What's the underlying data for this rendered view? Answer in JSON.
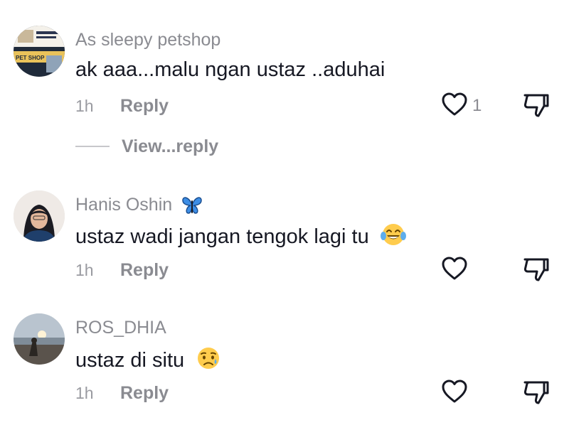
{
  "comments": [
    {
      "username": "As sleepy petshop",
      "text": "ak aaa...malu ngan ustaz ..aduhai",
      "emoji": "",
      "time": "1h",
      "reply_label": "Reply",
      "like_count": "1",
      "view_replies_label": "View...reply",
      "avatar_text": "PET SHOP"
    },
    {
      "username": "Hanis Oshin",
      "username_emoji": "butterfly-emoji",
      "text": "ustaz wadi jangan tengok lagi tu",
      "emoji": "tears-of-joy-emoji",
      "time": "1h",
      "reply_label": "Reply",
      "like_count": ""
    },
    {
      "username": "ROS_DHIA",
      "text": "ustaz di situ",
      "emoji": "sad-relieved-emoji",
      "time": "1h",
      "reply_label": "Reply",
      "like_count": ""
    }
  ],
  "colors": {
    "primary_text": "#161823",
    "secondary_text": "#8a8b91",
    "icon_stroke": "#161823",
    "background": "#ffffff"
  },
  "icons": [
    "heart-outline-icon",
    "dislike-icon"
  ]
}
